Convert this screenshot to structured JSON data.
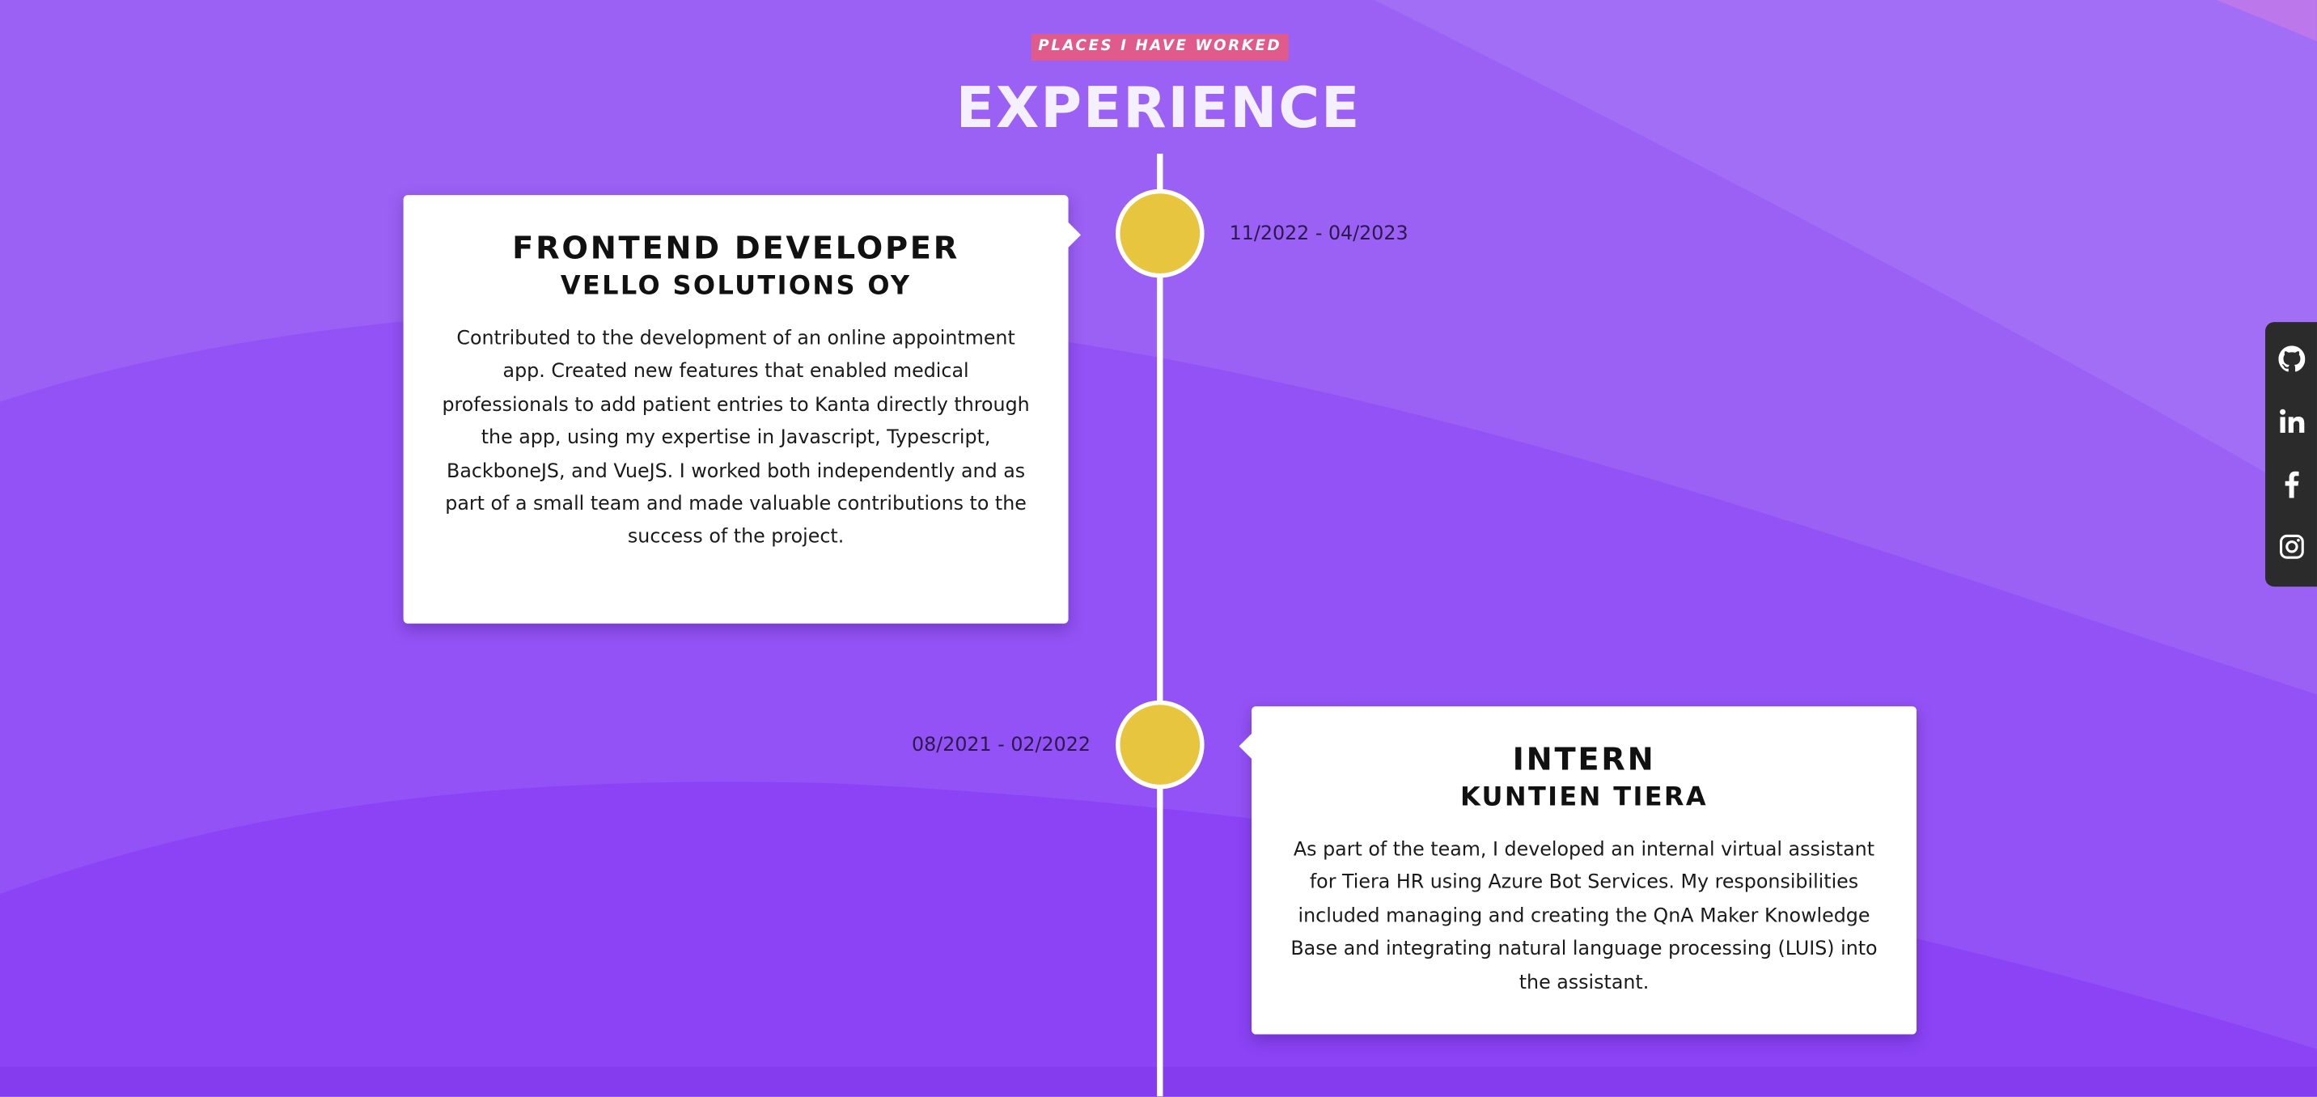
{
  "section": {
    "badge": "PLACES I HAVE WORKED",
    "title": "EXPERIENCE"
  },
  "colors": {
    "background": "#9a5df3",
    "badge": "#e05a8c",
    "timeline_dot": "#e8c53f",
    "card": "#ffffff",
    "social_bar": "#2b2b2b"
  },
  "experience": [
    {
      "role": "FRONTEND DEVELOPER",
      "company": "VELLO SOLUTIONS OY",
      "dates": "11/2022 - 04/2023",
      "description": "Contributed to the development of an online appointment app. Created new features that enabled medical professionals to add patient entries to Kanta directly through the app, using my expertise in Javascript, Typescript, BackboneJS, and VueJS. I worked both independently and as part of a small team and made valuable contributions to the success of the project."
    },
    {
      "role": "INTERN",
      "company": "KUNTIEN TIERA",
      "dates": "08/2021 - 02/2022",
      "description": "As part of the team, I developed an internal virtual assistant for Tiera HR using Azure Bot Services. My responsibilities included managing and creating the QnA Maker Knowledge Base and integrating natural language processing (LUIS) into the assistant."
    }
  ],
  "social": [
    {
      "icon": "github-icon"
    },
    {
      "icon": "linkedin-icon"
    },
    {
      "icon": "facebook-icon"
    },
    {
      "icon": "instagram-icon"
    }
  ]
}
